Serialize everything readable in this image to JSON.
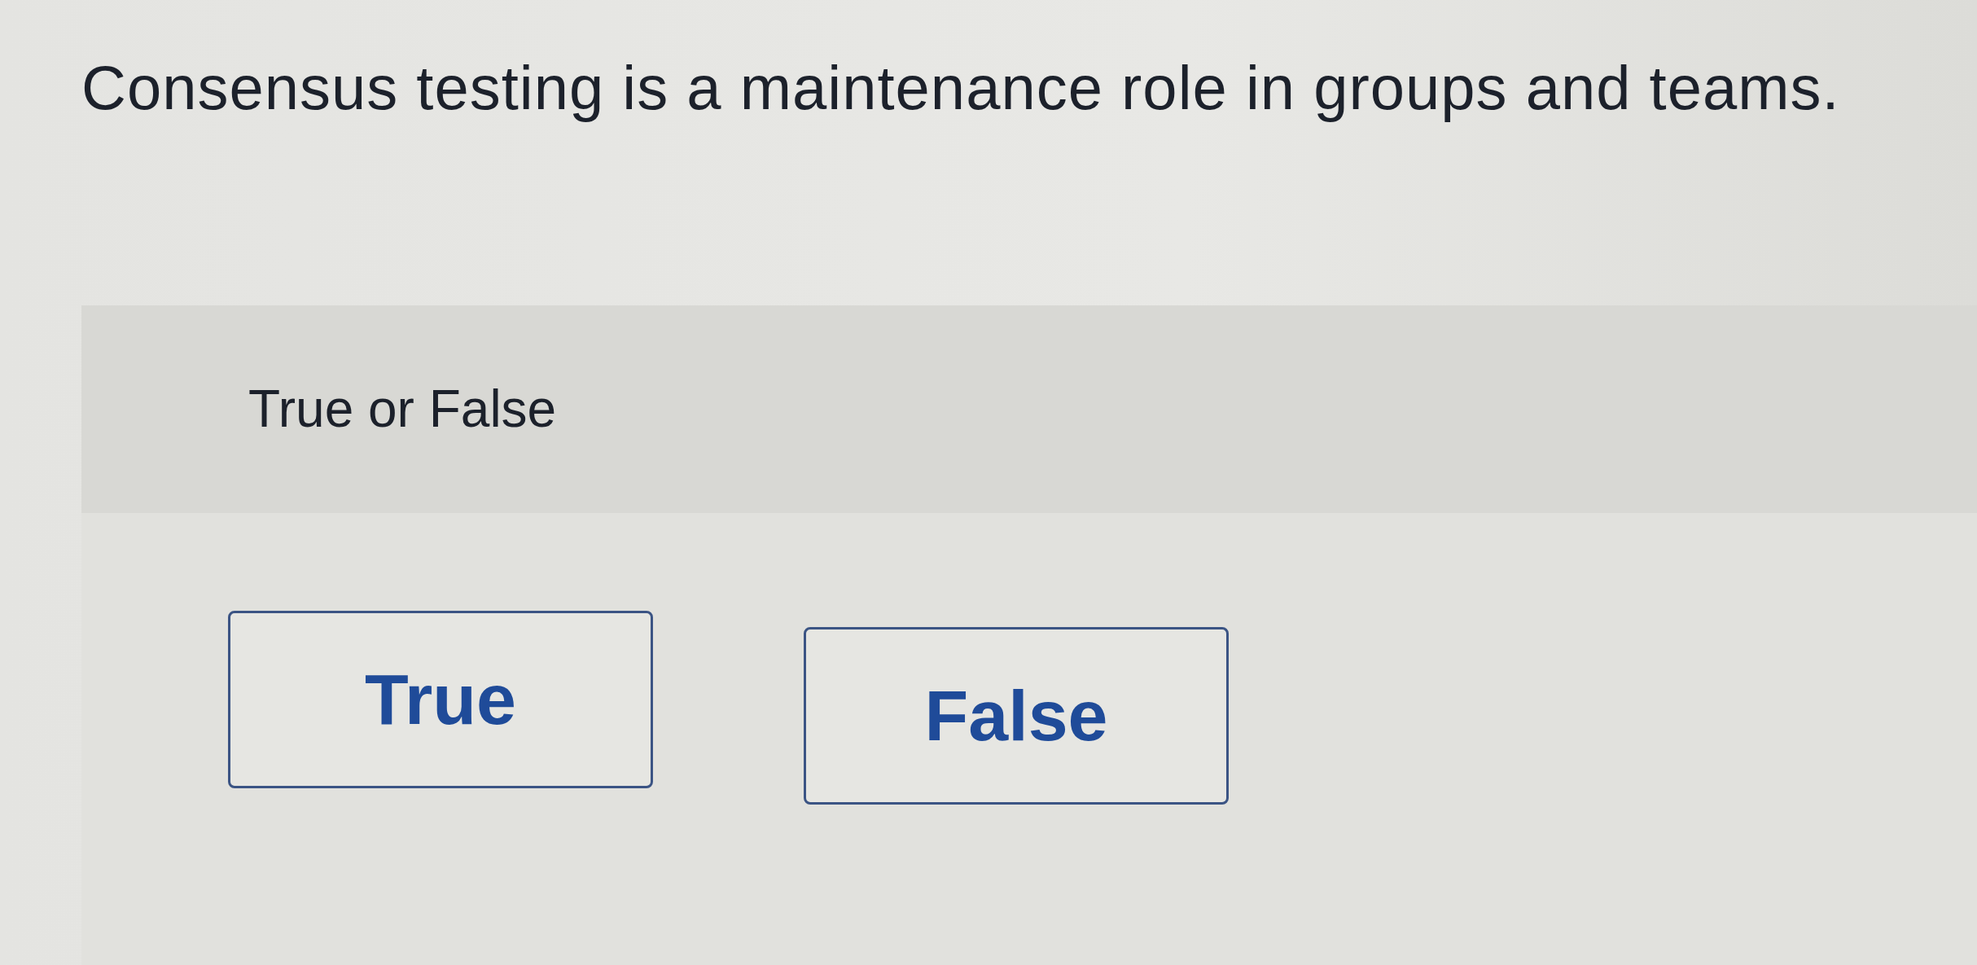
{
  "question": "Consensus testing is a maintenance role in groups and teams.",
  "panel": {
    "instruction": "True or False",
    "options": [
      {
        "label": "True",
        "selected": false
      },
      {
        "label": "False",
        "selected": false
      }
    ]
  }
}
